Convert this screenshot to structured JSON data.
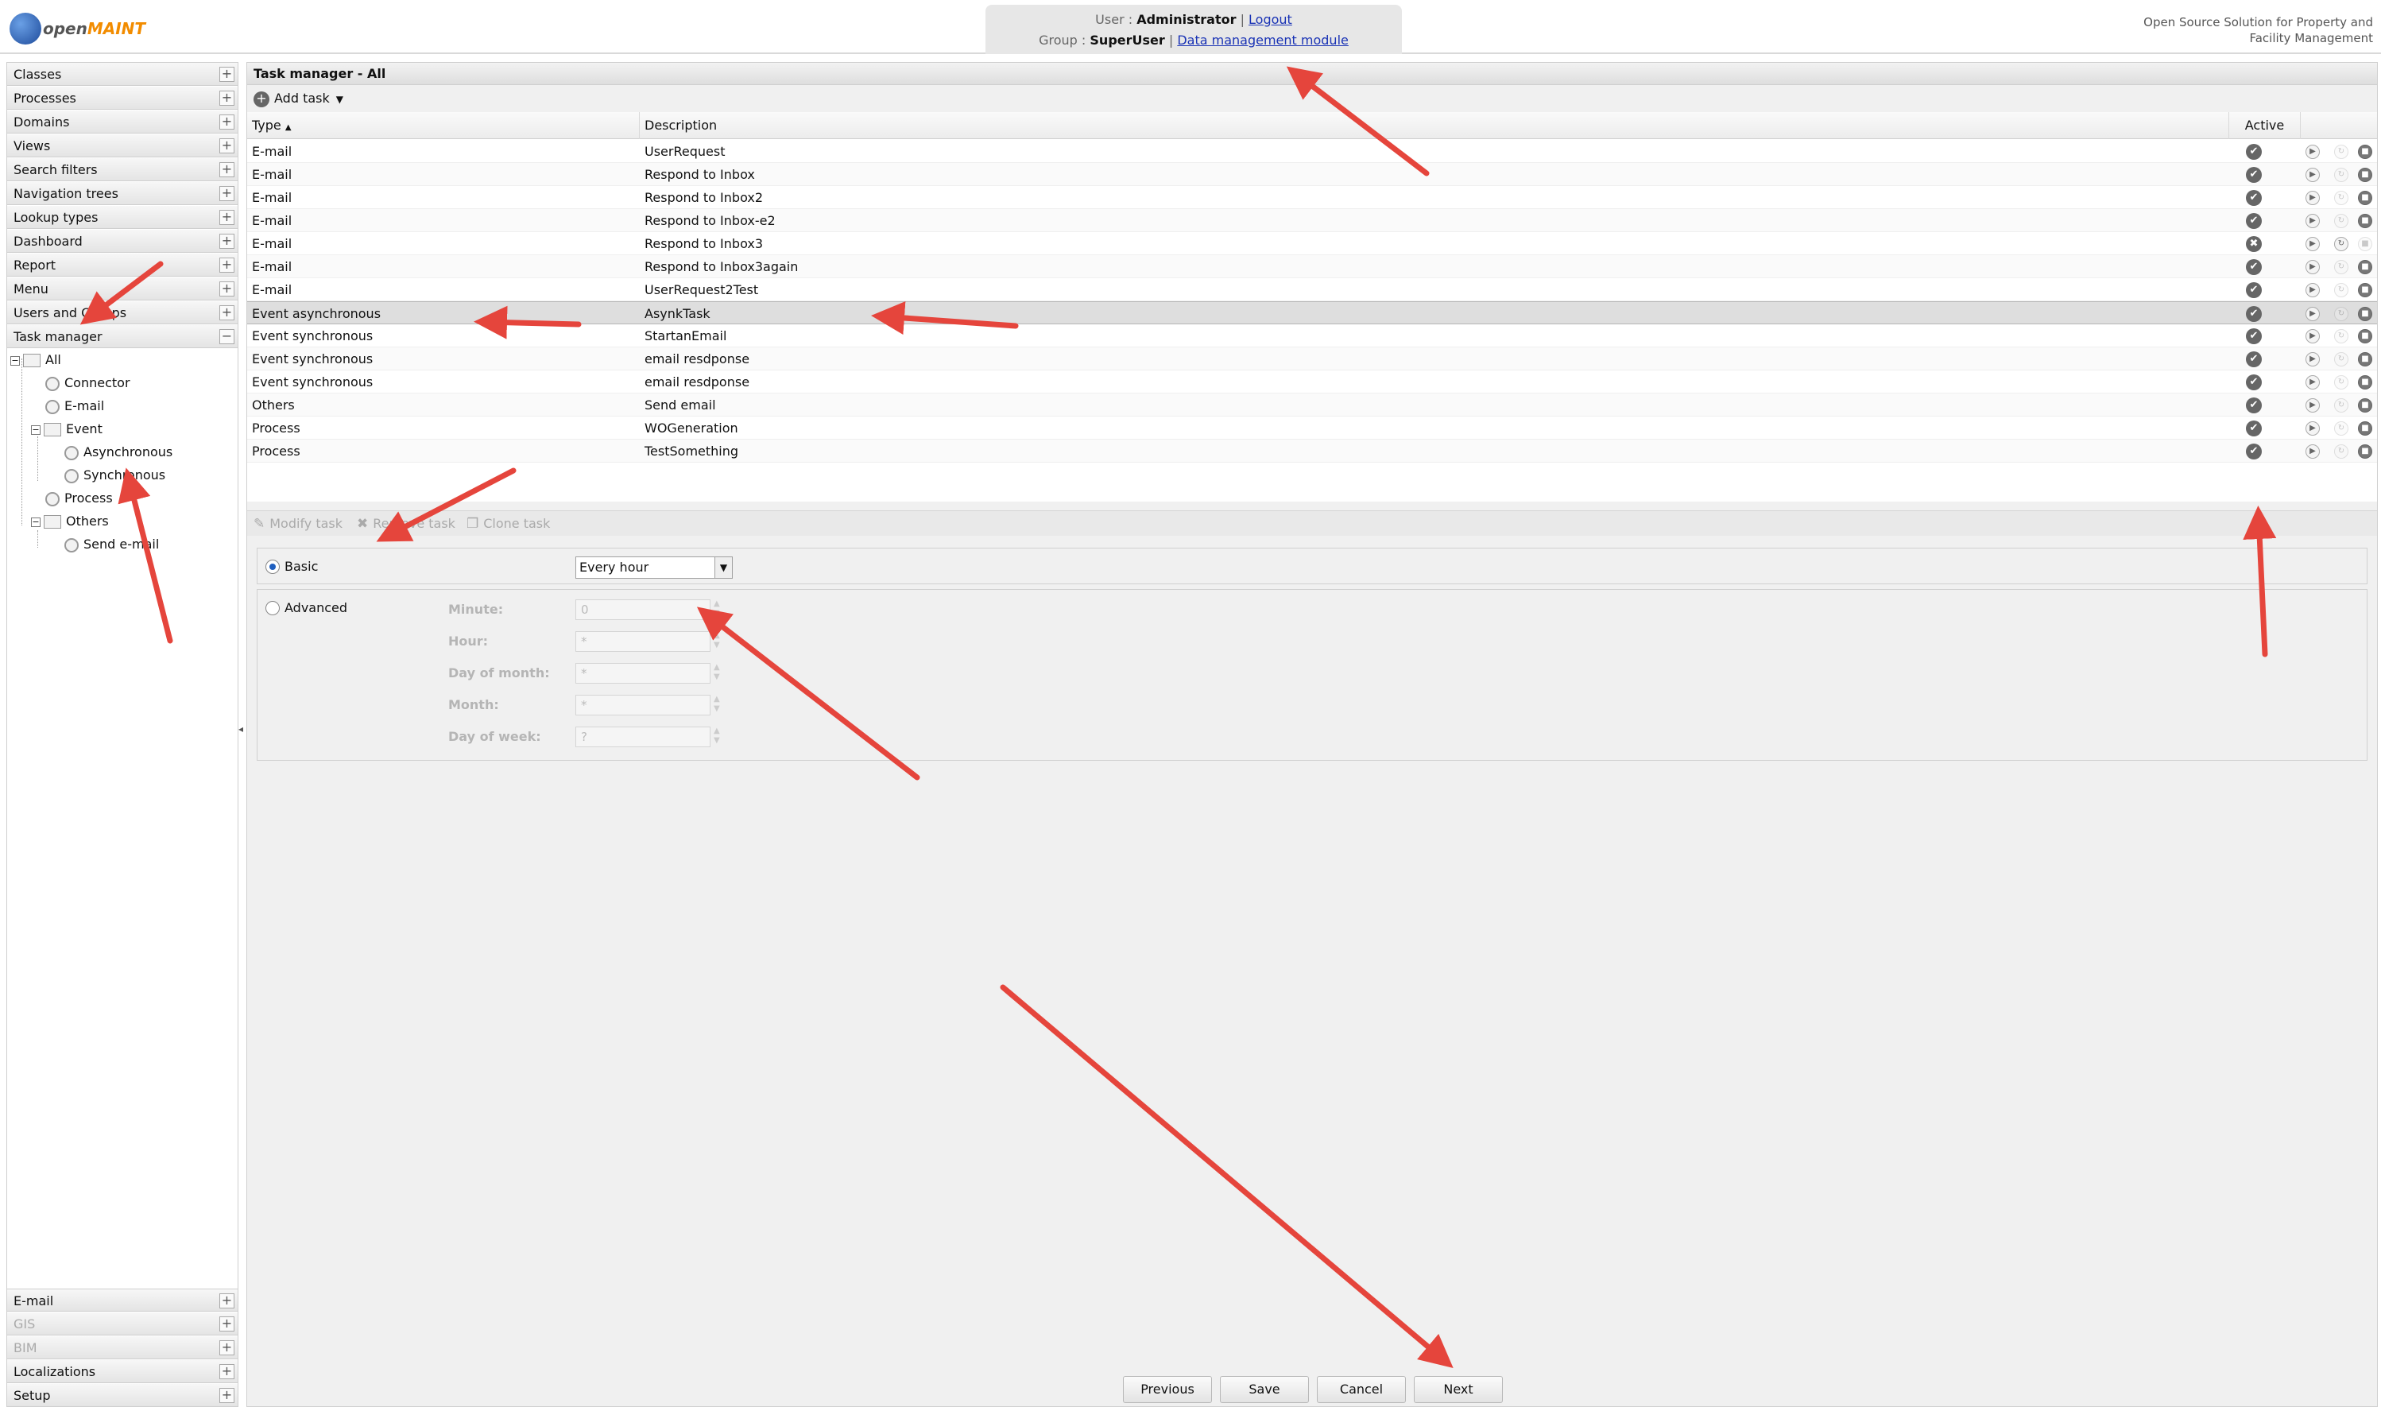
{
  "header": {
    "logo_text_a": "open",
    "logo_text_b": "MAINT",
    "user_label": "User :",
    "user_name": "Administrator",
    "logout": "Logout",
    "group_label": "Group :",
    "group_name": "SuperUser",
    "module_link": "Data management module",
    "tagline_1": "Open Source Solution for Property and",
    "tagline_2": "Facility Management"
  },
  "sidebar": {
    "top_items": [
      "Classes",
      "Processes",
      "Domains",
      "Views",
      "Search filters",
      "Navigation trees",
      "Lookup types",
      "Dashboard",
      "Report",
      "Menu",
      "Users and Groups",
      "Task manager"
    ],
    "expanded_symbol": "−",
    "plus_symbol": "+",
    "tree": {
      "root": "All",
      "connector": "Connector",
      "email": "E-mail",
      "event": "Event",
      "asynchronous": "Asynchronous",
      "synchronous": "Synchronous",
      "process": "Process",
      "others": "Others",
      "send_email": "Send e-mail"
    },
    "bottom_items": [
      {
        "label": "E-mail",
        "disabled": false
      },
      {
        "label": "GIS",
        "disabled": true
      },
      {
        "label": "BIM",
        "disabled": true
      },
      {
        "label": "Localizations",
        "disabled": false
      },
      {
        "label": "Setup",
        "disabled": false
      }
    ]
  },
  "main": {
    "title": "Task manager - All",
    "add_task": "Add task",
    "columns": {
      "type": "Type",
      "description": "Description",
      "active": "Active"
    },
    "rows": [
      {
        "type": "E-mail",
        "description": "UserRequest",
        "active": true
      },
      {
        "type": "E-mail",
        "description": "Respond to Inbox",
        "active": true
      },
      {
        "type": "E-mail",
        "description": "Respond to Inbox2",
        "active": true
      },
      {
        "type": "E-mail",
        "description": "Respond to Inbox-e2",
        "active": true
      },
      {
        "type": "E-mail",
        "description": "Respond to Inbox3",
        "active": false
      },
      {
        "type": "E-mail",
        "description": "Respond to Inbox3again",
        "active": true
      },
      {
        "type": "E-mail",
        "description": "UserRequest2Test",
        "active": true
      },
      {
        "type": "Event asynchronous",
        "description": "AsynkTask",
        "active": true
      },
      {
        "type": "Event synchronous",
        "description": "StartanEmail",
        "active": true
      },
      {
        "type": "Event synchronous",
        "description": "email resdponse",
        "active": true
      },
      {
        "type": "Event synchronous",
        "description": "email resdponse",
        "active": true
      },
      {
        "type": "Others",
        "description": "Send email",
        "active": true
      },
      {
        "type": "Process",
        "description": "WOGeneration",
        "active": true
      },
      {
        "type": "Process",
        "description": "TestSomething",
        "active": true
      }
    ],
    "selected_row": 7,
    "toolbar2": {
      "modify": "Modify task",
      "remove": "Remove task",
      "clone": "Clone task"
    },
    "form": {
      "basic": "Basic",
      "basic_value": "Every hour",
      "advanced": "Advanced",
      "fields": [
        {
          "label": "Minute:",
          "value": "0"
        },
        {
          "label": "Hour:",
          "value": "*"
        },
        {
          "label": "Day of month:",
          "value": "*"
        },
        {
          "label": "Month:",
          "value": "*"
        },
        {
          "label": "Day of week:",
          "value": "?"
        }
      ]
    },
    "buttons": {
      "previous": "Previous",
      "save": "Save",
      "cancel": "Cancel",
      "next": "Next"
    }
  },
  "colors": {
    "accent": "#f28c00",
    "link": "#1a33b5",
    "arrow": "#e5453c"
  }
}
